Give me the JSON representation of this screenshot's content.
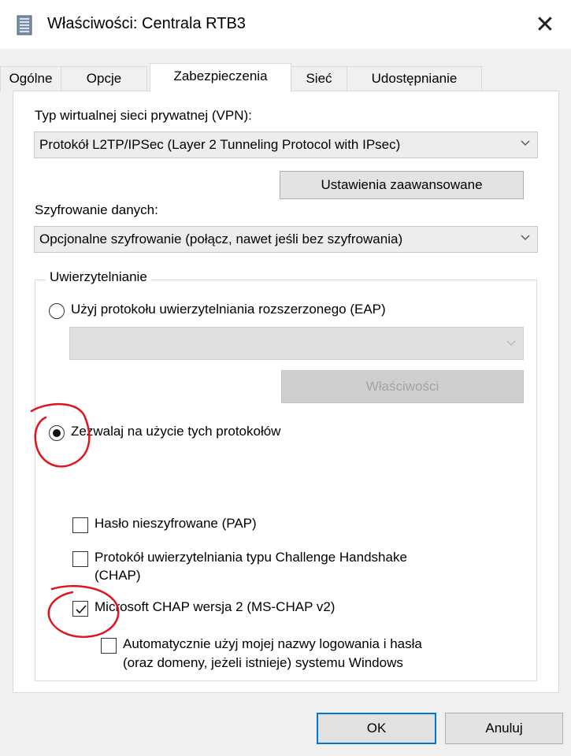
{
  "window": {
    "title": "Właściwości: Centrala RTB3",
    "close_glyph": "✕"
  },
  "tabs": [
    {
      "label": "Ogólne",
      "active": false
    },
    {
      "label": "Opcje",
      "active": false
    },
    {
      "label": "Zabezpieczenia",
      "active": true
    },
    {
      "label": "Sieć",
      "active": false
    },
    {
      "label": "Udostępnianie",
      "active": false
    }
  ],
  "vpn": {
    "label": "Typ wirtualnej sieci prywatnej (VPN):",
    "value": "Protokół L2TP/IPSec (Layer 2 Tunneling Protocol with IPsec)"
  },
  "advanced_button": "Ustawienia zaawansowane",
  "encryption": {
    "label": "Szyfrowanie danych:",
    "value": "Opcjonalne szyfrowanie (połącz, nawet jeśli bez szyfrowania)"
  },
  "auth": {
    "group_title": "Uwierzytelnianie",
    "eap_radio": {
      "label": "Użyj protokołu uwierzytelniania rozszerzonego (EAP)",
      "checked": false
    },
    "eap_combo_value": "",
    "eap_properties_button": "Właściwości",
    "allow_radio": {
      "label": "Zezwalaj na użycie tych protokołów",
      "checked": true
    },
    "pap": {
      "label": "Hasło nieszyfrowane (PAP)",
      "checked": false
    },
    "chap": {
      "label_line1": "Protokół uwierzytelniania typu Challenge Handshake",
      "label_line2": "(CHAP)",
      "checked": false
    },
    "mschap": {
      "label": "Microsoft CHAP wersja 2 (MS-CHAP v2)",
      "checked": true
    },
    "auto_logon": {
      "label_line1": "Automatycznie użyj mojej nazwy logowania i hasła",
      "label_line2": "(oraz domeny, jeżeli istnieje) systemu Windows",
      "checked": false
    }
  },
  "footer": {
    "ok": "OK",
    "cancel": "Anuluj"
  },
  "colors": {
    "focus_border": "#0078d7",
    "annotation": "#e0141e"
  }
}
